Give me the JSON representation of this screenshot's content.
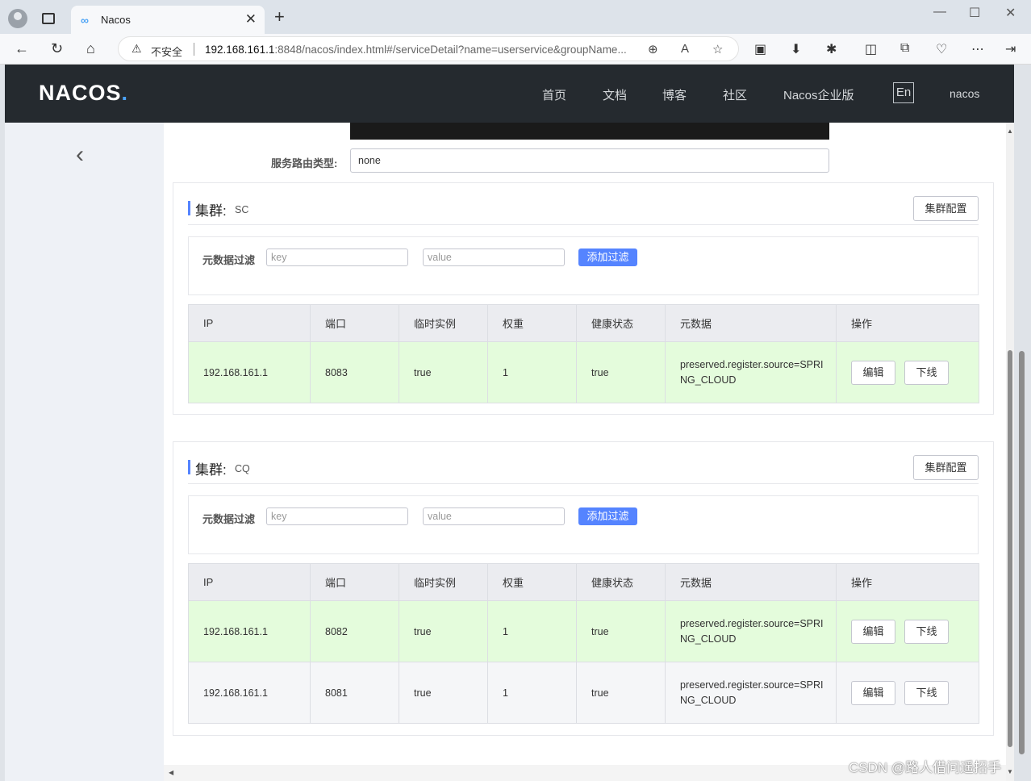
{
  "browser": {
    "tab_title": "Nacos",
    "tab_favicon": "∞",
    "new_tab": "+",
    "insecure_label": "不安全",
    "url_host": "192.168.161.1",
    "url_rest": ":8848/nacos/index.html#/serviceDetail?name=userservice&groupName..."
  },
  "header": {
    "logo": "NACOS",
    "menu": [
      "首页",
      "文档",
      "博客",
      "社区",
      "Nacos企业版"
    ],
    "lang": "En",
    "user": "nacos"
  },
  "service": {
    "route_type_label": "服务路由类型:",
    "route_type_value": "none"
  },
  "labels": {
    "cluster": "集群:",
    "cluster_config": "集群配置",
    "metadata_filter": "元数据过滤",
    "key_placeholder": "key",
    "value_placeholder": "value",
    "add_filter": "添加过滤",
    "edit": "编辑",
    "offline": "下线"
  },
  "columns": [
    "IP",
    "端口",
    "临时实例",
    "权重",
    "健康状态",
    "元数据",
    "操作"
  ],
  "clusters": [
    {
      "name": "SC",
      "instances": [
        {
          "ip": "192.168.161.1",
          "port": "8083",
          "ephemeral": "true",
          "weight": "1",
          "healthy": "true",
          "metadata": "preserved.register.source=SPRING_CLOUD"
        }
      ]
    },
    {
      "name": "CQ",
      "instances": [
        {
          "ip": "192.168.161.1",
          "port": "8082",
          "ephemeral": "true",
          "weight": "1",
          "healthy": "true",
          "metadata": "preserved.register.source=SPRING_CLOUD"
        },
        {
          "ip": "192.168.161.1",
          "port": "8081",
          "ephemeral": "true",
          "weight": "1",
          "healthy": "true",
          "metadata": "preserved.register.source=SPRING_CLOUD"
        }
      ]
    }
  ],
  "watermark": "CSDN @路人借问遥招手",
  "colors": {
    "header_bg": "#252a2f",
    "primary": "#5584ff",
    "healthy_row": "#e4fcdc"
  }
}
